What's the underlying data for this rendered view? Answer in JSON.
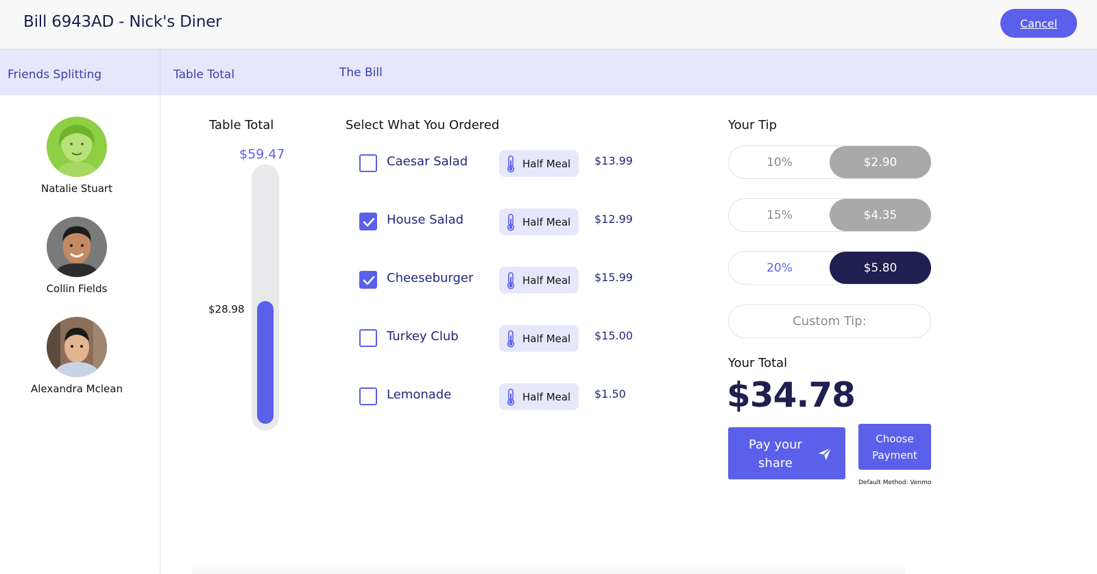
{
  "header": {
    "title": "Bill 6943AD - Nick's Diner",
    "cancel_label": "Cancel"
  },
  "tabs": {
    "friends": "Friends Splitting",
    "table_total": "Table Total",
    "the_bill": "The Bill"
  },
  "friends": [
    {
      "name": "Natalie Stuart"
    },
    {
      "name": "Collin Fields"
    },
    {
      "name": "Alexandra Mclean"
    }
  ],
  "table_total": {
    "heading": "Table Total",
    "total": "$59.47",
    "your_share": "$28.98",
    "share_fraction": 0.487
  },
  "order": {
    "heading": "Select What You Ordered",
    "half_meal_label": "Half Meal",
    "items": [
      {
        "name": "Caesar Salad",
        "price": "$13.99",
        "checked": false
      },
      {
        "name": "House Salad",
        "price": "$12.99",
        "checked": true
      },
      {
        "name": "Cheeseburger",
        "price": "$15.99",
        "checked": true
      },
      {
        "name": "Turkey Club",
        "price": "$15.00",
        "checked": false
      },
      {
        "name": "Lemonade",
        "price": "$1.50",
        "checked": false
      }
    ]
  },
  "tip": {
    "heading": "Your Tip",
    "options": [
      {
        "percent": "10%",
        "amount": "$2.90",
        "selected": false
      },
      {
        "percent": "15%",
        "amount": "$4.35",
        "selected": false
      },
      {
        "percent": "20%",
        "amount": "$5.80",
        "selected": true
      }
    ],
    "custom_label": "Custom Tip:"
  },
  "total": {
    "heading": "Your Total",
    "amount": "$34.78"
  },
  "actions": {
    "pay_label": "Pay your share",
    "choose_payment_label": "Choose Payment",
    "default_method": "Default Method: Venmo"
  },
  "colors": {
    "accent": "#5a60ea",
    "dark": "#1e2050",
    "tab_bg": "#e6e7fb"
  }
}
